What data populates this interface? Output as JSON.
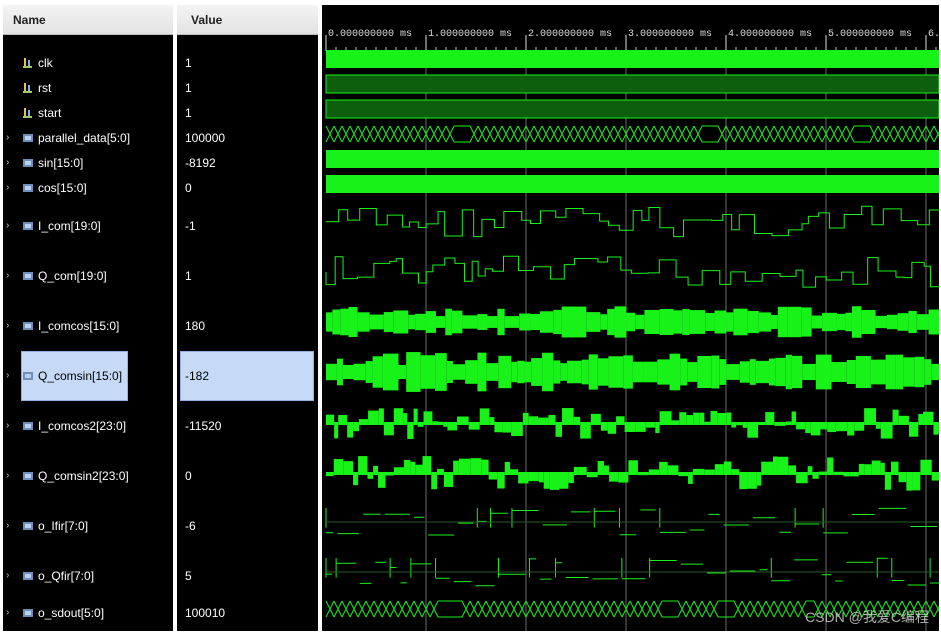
{
  "columns": {
    "name": "Name",
    "value": "Value"
  },
  "timeline": {
    "ticks": [
      "0.000000000 ms",
      "1.000000000 ms",
      "2.000000000 ms",
      "3.000000000 ms",
      "4.000000000 ms",
      "5.000000000 ms",
      "6."
    ]
  },
  "signals": [
    {
      "name": "clk",
      "value": "1",
      "kind": "bit",
      "expandable": false,
      "icon": "bit-signal-icon"
    },
    {
      "name": "rst",
      "value": "1",
      "kind": "bit",
      "expandable": false,
      "icon": "bit-signal-icon"
    },
    {
      "name": "start",
      "value": "1",
      "kind": "bit",
      "expandable": false,
      "icon": "bit-signal-icon"
    },
    {
      "name": "parallel_data[5:0]",
      "value": "100000",
      "kind": "bus",
      "expandable": true,
      "icon": "bus-signal-icon"
    },
    {
      "name": "sin[15:0]",
      "value": "-8192",
      "kind": "bus",
      "expandable": true,
      "icon": "bus-signal-icon"
    },
    {
      "name": "cos[15:0]",
      "value": "0",
      "kind": "bus",
      "expandable": true,
      "icon": "bus-signal-icon"
    },
    {
      "name": "I_com[19:0]",
      "value": "-1",
      "kind": "analog",
      "expandable": true,
      "icon": "bus-signal-icon"
    },
    {
      "name": "Q_com[19:0]",
      "value": "1",
      "kind": "analog",
      "expandable": true,
      "icon": "bus-signal-icon"
    },
    {
      "name": "I_comcos[15:0]",
      "value": "180",
      "kind": "analog",
      "expandable": true,
      "icon": "bus-signal-icon"
    },
    {
      "name": "Q_comsin[15:0]",
      "value": "-182",
      "kind": "analog",
      "expandable": true,
      "icon": "bus-signal-icon",
      "selected": true
    },
    {
      "name": "I_comcos2[23:0]",
      "value": "-11520",
      "kind": "analog",
      "expandable": true,
      "icon": "bus-signal-icon"
    },
    {
      "name": "Q_comsin2[23:0]",
      "value": "0",
      "kind": "analog",
      "expandable": true,
      "icon": "bus-signal-icon"
    },
    {
      "name": "o_Ifir[7:0]",
      "value": "-6",
      "kind": "analog",
      "expandable": true,
      "icon": "bus-signal-icon"
    },
    {
      "name": "o_Qfir[7:0]",
      "value": "5",
      "kind": "analog",
      "expandable": true,
      "icon": "bus-signal-icon"
    },
    {
      "name": "o_sdout[5:0]",
      "value": "100010",
      "kind": "bus",
      "expandable": true,
      "icon": "bus-signal-icon"
    }
  ],
  "colors": {
    "wave": "#19f219",
    "wave_dim": "#0d5f0d",
    "grid": "#6a6a6a",
    "selection": "#c6daf7",
    "panel_bg": "#000000"
  },
  "watermark": "CSDN @我爱C编程"
}
